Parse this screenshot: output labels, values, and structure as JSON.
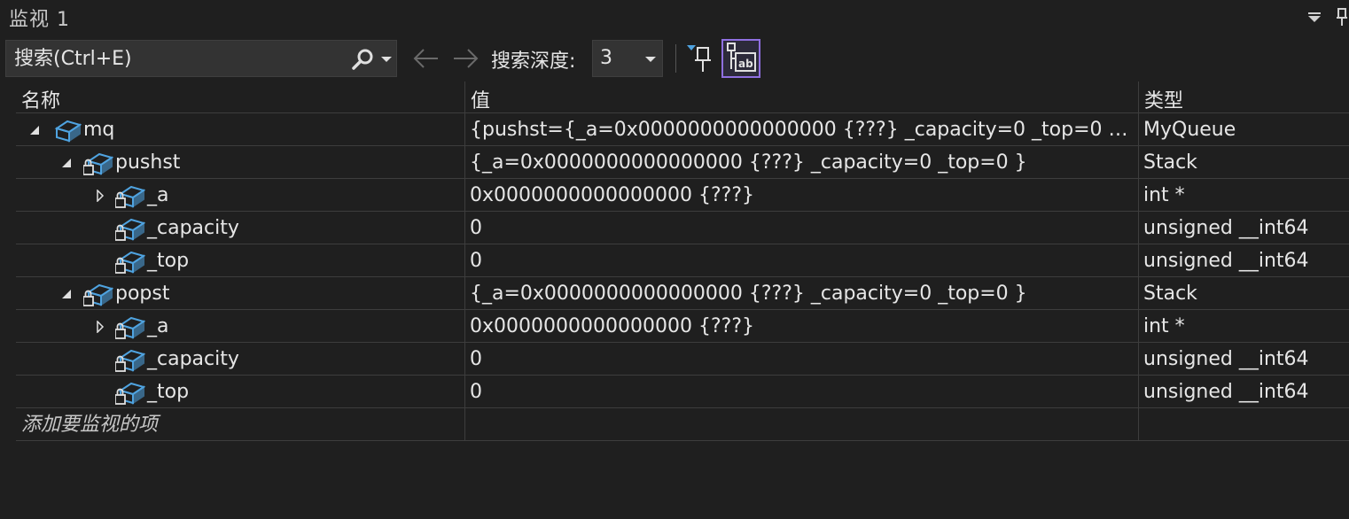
{
  "window": {
    "title": "监视 1"
  },
  "toolbar": {
    "search_placeholder": "搜索(Ctrl+E)",
    "depth_label": "搜索深度:",
    "depth_value": "3"
  },
  "columns": {
    "name": "名称",
    "value": "值",
    "type": "类型"
  },
  "rows": [
    {
      "name": "mq",
      "value": "{pushst={_a=0x0000000000000000 {???} _capacity=0 _top=0 } p...",
      "type": "MyQueue",
      "level": 0,
      "expander": "expanded",
      "icon": "class-variable-icon"
    },
    {
      "name": "pushst",
      "value": "{_a=0x0000000000000000 {???} _capacity=0 _top=0 }",
      "type": "Stack",
      "level": 1,
      "expander": "expanded",
      "icon": "private-field-icon"
    },
    {
      "name": "_a",
      "value": "0x0000000000000000 {???}",
      "type": "int *",
      "level": 2,
      "expander": "collapsed",
      "icon": "private-field-icon"
    },
    {
      "name": "_capacity",
      "value": "0",
      "type": "unsigned __int64",
      "level": 2,
      "expander": "none",
      "icon": "private-field-icon"
    },
    {
      "name": "_top",
      "value": "0",
      "type": "unsigned __int64",
      "level": 2,
      "expander": "none",
      "icon": "private-field-icon"
    },
    {
      "name": "popst",
      "value": "{_a=0x0000000000000000 {???} _capacity=0 _top=0 }",
      "type": "Stack",
      "level": 1,
      "expander": "expanded",
      "icon": "private-field-icon"
    },
    {
      "name": "_a",
      "value": "0x0000000000000000 {???}",
      "type": "int *",
      "level": 2,
      "expander": "collapsed",
      "icon": "private-field-icon"
    },
    {
      "name": "_capacity",
      "value": "0",
      "type": "unsigned __int64",
      "level": 2,
      "expander": "none",
      "icon": "private-field-icon"
    },
    {
      "name": "_top",
      "value": "0",
      "type": "unsigned __int64",
      "level": 2,
      "expander": "none",
      "icon": "private-field-icon"
    }
  ],
  "add_item_text": "添加要监视的项",
  "colors": {
    "background": "#1f1f1f",
    "icon_blue": "#4fa3e0",
    "selected_button_border": "#8f6fe0",
    "pin_filter_accent": "#4fa3e0"
  }
}
